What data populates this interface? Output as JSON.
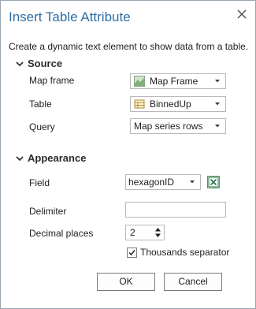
{
  "dialog": {
    "title": "Insert Table Attribute",
    "description": "Create a dynamic text element to show data from a table."
  },
  "source": {
    "heading": "Source",
    "map_frame_label": "Map frame",
    "map_frame_value": "Map Frame",
    "table_label": "Table",
    "table_value": "BinnedUp",
    "query_label": "Query",
    "query_value": "Map series rows"
  },
  "appearance": {
    "heading": "Appearance",
    "field_label": "Field",
    "field_value": "hexagonID",
    "delimiter_label": "Delimiter",
    "delimiter_value": "",
    "decimal_places_label": "Decimal places",
    "decimal_places_value": "2",
    "thousands_separator_label": "Thousands separator",
    "thousands_separator_checked": true
  },
  "buttons": {
    "ok_label": "OK",
    "cancel_label": "Cancel"
  },
  "icons": {
    "close": "close-icon",
    "map_frame": "map-frame-icon",
    "table": "table-icon",
    "field_expression": "excel-expression-icon",
    "dropdown": "chevron-down-icon",
    "section_toggle": "chevron-down-icon"
  },
  "colors": {
    "title": "#2f6ea5",
    "border": "#9aa6b2",
    "expression_green": "#217346"
  }
}
